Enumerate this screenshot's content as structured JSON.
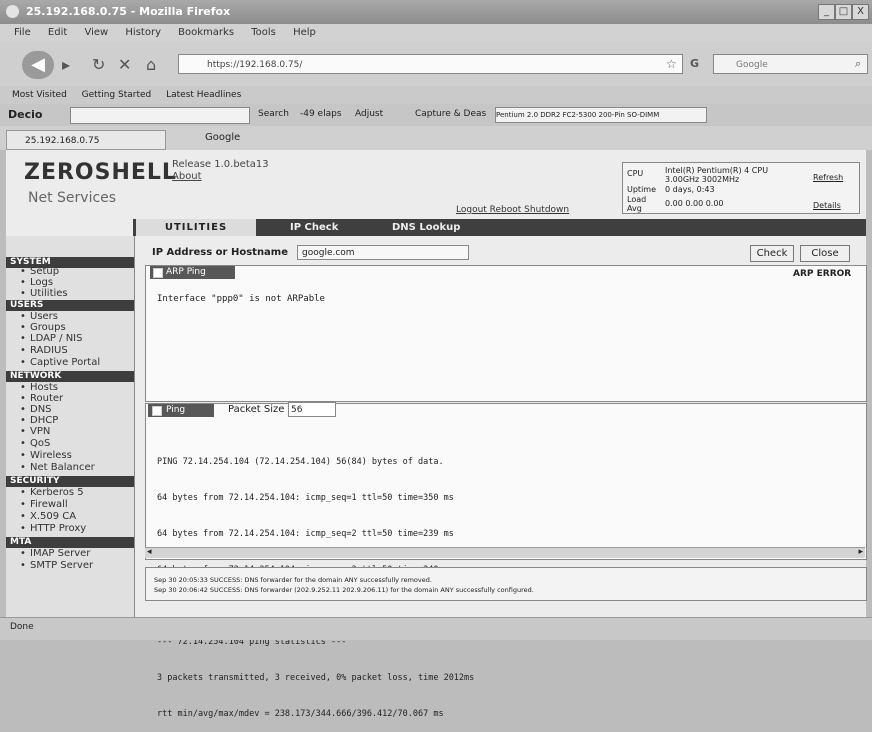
{
  "window": {
    "title": "25.192.168.0.75 - Mozilla Firefox",
    "btn_min": "_",
    "btn_max": "□",
    "btn_close": "X"
  },
  "menu": [
    "File",
    "Edit",
    "View",
    "History",
    "Bookmarks",
    "Tools",
    "Help"
  ],
  "nav": {
    "url": "https://192.168.0.75/",
    "search_placeholder": "Google"
  },
  "bookmarks": [
    "Most Visited",
    "Getting Started",
    "Latest Headlines"
  ],
  "decio": {
    "label": "Decio",
    "search_label": "Search",
    "btn_min": "-49 elaps",
    "btn_alpha": "Adjust",
    "capture": "Capture & Deas",
    "select": "Pentium 2.0 DDR2 FC2-5300 200-Pin SO-DIMM"
  },
  "tabs": {
    "active": "25.192.168.0.75",
    "second": "Google"
  },
  "app": {
    "logo": "ZEROSHELL",
    "logo_sub": "Net Services",
    "release": "Release 1.0.beta13",
    "about": "About",
    "top_links": "Logout  Reboot  Shutdown",
    "cpu_label": "CPU",
    "cpu_value": "Intel(R) Pentium(R) 4 CPU 3.00GHz 3002MHz",
    "uptime_label": "Uptime",
    "uptime_value": "0 days, 0:43",
    "load_label": "Load Avg",
    "load_value": "0.00 0.00 0.00",
    "refresh": "Refresh",
    "details": "Details"
  },
  "app_tabs": {
    "utilities": "UTILITIES",
    "ipcheck": "IP Check",
    "dns": "DNS Lookup"
  },
  "sidebar": {
    "sections": [
      {
        "title": "SYSTEM",
        "items": [
          "Setup",
          "Logs",
          "Utilities"
        ]
      },
      {
        "title": "USERS",
        "items": [
          "Users",
          "Groups",
          "LDAP / NIS",
          "RADIUS",
          "Captive Portal"
        ]
      },
      {
        "title": "NETWORK",
        "items": [
          "Hosts",
          "Router",
          "DNS",
          "DHCP",
          "VPN",
          "QoS",
          "Wireless",
          "Net Balancer"
        ]
      },
      {
        "title": "SECURITY",
        "items": [
          "Kerberos 5",
          "Firewall",
          "X.509 CA",
          "HTTP Proxy"
        ]
      },
      {
        "title": "MTA",
        "items": [
          "IMAP Server",
          "SMTP Server"
        ]
      }
    ]
  },
  "ipform": {
    "label": "IP Address or Hostname",
    "value": "google.com",
    "check": "Check",
    "close": "Close"
  },
  "arp": {
    "title": "ARP Ping",
    "status": "ARP ERROR",
    "message": "Interface \"ppp0\" is not ARPable"
  },
  "ping": {
    "title": "Ping",
    "packet_label": "Packet Size",
    "packet_value": "56",
    "lines": [
      "PING 72.14.254.104 (72.14.254.104) 56(84) bytes of data.",
      "64 bytes from 72.14.254.104: icmp_seq=1 ttl=50 time=350 ms",
      "64 bytes from 72.14.254.104: icmp_seq=2 ttl=50 time=239 ms",
      "64 bytes from 72.14.254.104: icmp_seq=3 ttl=50 time=340 ms",
      "",
      "--- 72.14.254.104 ping statistics ---",
      "3 packets transmitted, 3 received, 0% packet loss, time 2012ms",
      "rtt min/avg/max/mdev = 238.173/344.666/396.412/70.067 ms"
    ]
  },
  "log": {
    "line1": "Sep 30 20:05:33 SUCCESS: DNS forwarder for the domain ANY successfully removed.",
    "line2": "Sep 30 20:06:42 SUCCESS: DNS forwarder (202.9.252.11 202.9.206.11) for the domain ANY successfully configured."
  },
  "status": {
    "text": "Done"
  }
}
